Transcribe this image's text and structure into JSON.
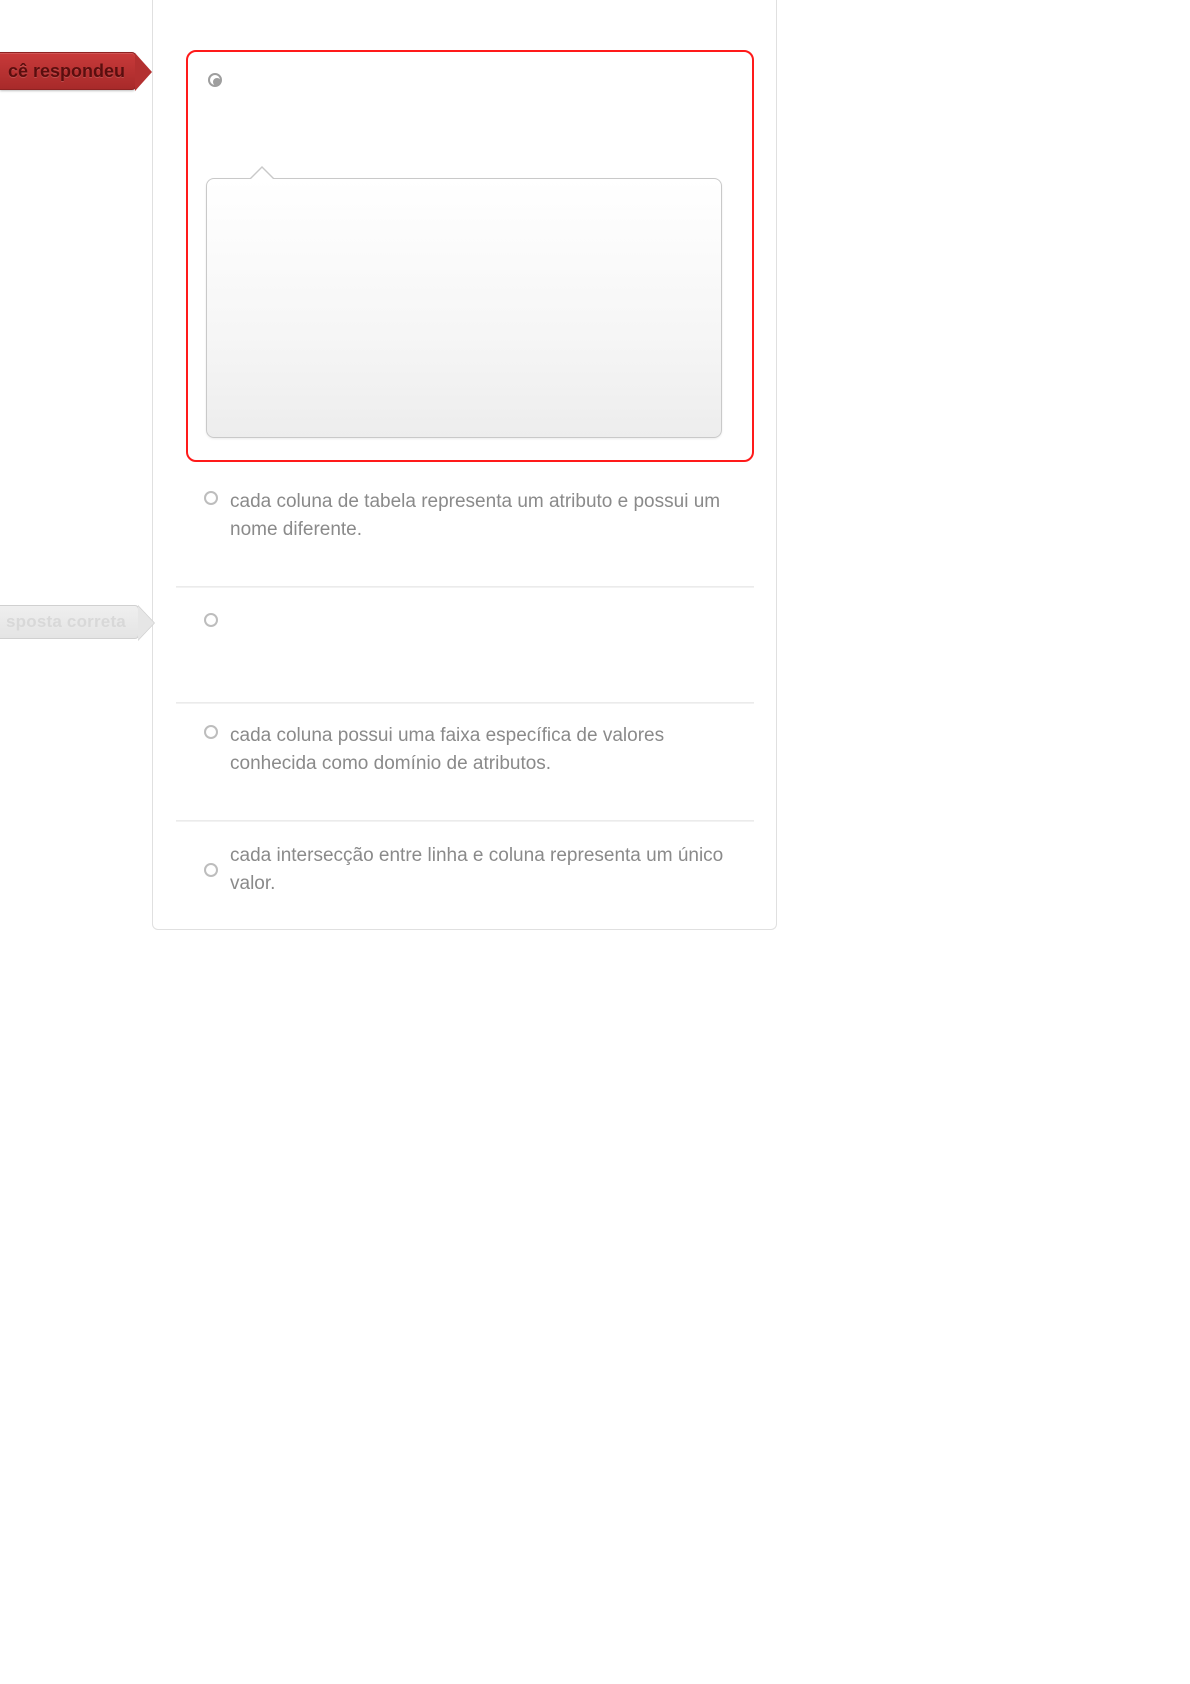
{
  "flags": {
    "answered_label": "cê respondeu",
    "correct_label": "sposta correta"
  },
  "options": {
    "a": {
      "text": ""
    },
    "b": {
      "text": "cada coluna de tabela representa um atributo e possui um nome diferente."
    },
    "c": {
      "text": ""
    },
    "d": {
      "text": "cada coluna possui uma faixa específica de valores conhecida como domínio de atributos."
    },
    "e": {
      "text": "cada intersecção entre linha e coluna representa um único valor."
    }
  }
}
